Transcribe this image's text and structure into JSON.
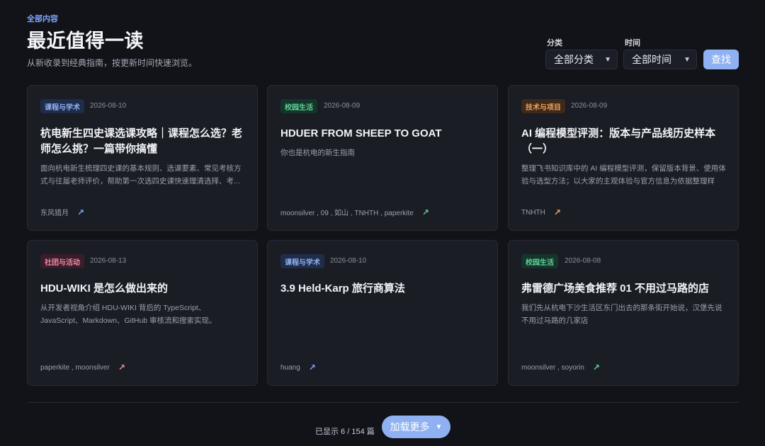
{
  "header": {
    "eyebrow": "全部内容",
    "title": "最近值得一读",
    "subtitle": "从新收录到经典指南，按更新时间快速浏览。"
  },
  "filters": {
    "category_label": "分类",
    "category_value": "全部分类",
    "time_label": "时间",
    "time_value": "全部时间",
    "search_label": "查找"
  },
  "cards": [
    {
      "tag": "课程与学术",
      "date": "2026-08-10",
      "title": "杭电新生四史课选课攻略｜课程怎么选？老师怎么挑？一篇带你搞懂",
      "desc": "面向杭电新生梳理四史课的基本规则、选课要素、常见考核方式与往届老师评价，帮助第一次选四史课快速理清选择、考...",
      "authors": "东风猎月"
    },
    {
      "tag": "校园生活",
      "date": "2026-08-09",
      "title": "HDUER FROM SHEEP TO GOAT",
      "desc": "你也是杭电的新生指南",
      "authors": "moonsilver , 09 , 如山 , TNHTH , paperkite"
    },
    {
      "tag": "技术与项目",
      "date": "2026-08-09",
      "title": "AI 编程模型评测：版本与产品线历史样本（一）",
      "desc": "整理飞书知识库中的 AI 编程模型评测，保留版本背景、使用体验与选型方法；以大家的主观体验与官方信息为依据整理样本。",
      "authors": "TNHTH"
    },
    {
      "tag": "社团与活动",
      "date": "2026-08-13",
      "title": "HDU-WIKI 是怎么做出来的",
      "desc": "从开发者视角介绍 HDU-WIKI 背后的 TypeScript、JavaScript、Markdown、GitHub 审核流和搜索实现。",
      "authors": "paperkite , moonsilver"
    },
    {
      "tag": "课程与学术",
      "date": "2026-08-10",
      "title": "3.9 Held-Karp 旅行商算法",
      "desc": "",
      "authors": "huang"
    },
    {
      "tag": "校园生活",
      "date": "2026-08-08",
      "title": "弗雷德广场美食推荐 01 不用过马路的店",
      "desc": "我们先从杭电下沙生活区东门出去的那条街开始说，汉堡先说不用过马路的几家店",
      "authors": "moonsilver , soyorin"
    }
  ],
  "footer": {
    "count_text": "已显示 6 / 154 篇",
    "load_more": "加载更多"
  },
  "icons": {
    "arrow": "↗",
    "chevron": "⌄"
  },
  "colors": {
    "background": "#111318",
    "card": "#1a1d24",
    "accent": "#8fb1f2"
  }
}
